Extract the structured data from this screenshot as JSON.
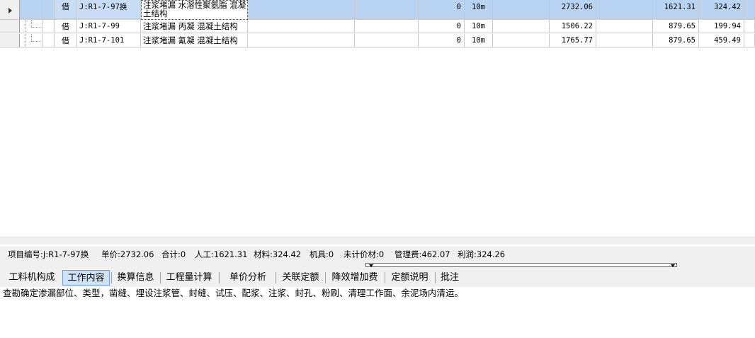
{
  "grid": {
    "rows": [
      {
        "type": "借",
        "code": "J:R1-7-97换",
        "name": "注浆堵漏 水溶性聚氨脂 混凝土结构",
        "qty": "0",
        "unit": "10m",
        "price": "2732.06",
        "labor": "1621.31",
        "material": "324.42",
        "selected": true
      },
      {
        "type": "借",
        "code": "J:R1-7-99",
        "name": "注浆堵漏 丙凝 混凝土结构",
        "qty": "0",
        "unit": "10m",
        "price": "1506.22",
        "labor": "879.65",
        "material": "199.94",
        "selected": false
      },
      {
        "type": "借",
        "code": "J:R1-7-101",
        "name": "注浆堵漏 氰凝 混凝土结构",
        "qty": "0",
        "unit": "10m",
        "price": "1765.77",
        "labor": "879.65",
        "material": "459.49",
        "selected": false
      }
    ]
  },
  "infobar": {
    "code": "项目编号:J:R1-7-97换",
    "unit_price": "单价:2732.06",
    "total": "合计:0",
    "labor": "人工:1621.31",
    "material": "材料:324.42",
    "machine": "机具:0",
    "unpriced": "未计价材:0",
    "mgmt": "管理费:462.07",
    "profit": "利润:324.26"
  },
  "tabs": [
    {
      "label": "工料机构成",
      "active": false
    },
    {
      "label": "工作内容",
      "active": true
    },
    {
      "label": "换算信息",
      "active": false
    },
    {
      "label": "工程量计算",
      "active": false
    },
    {
      "label": "单价分析",
      "active": false
    },
    {
      "label": "关联定额",
      "active": false
    },
    {
      "label": "降效增加费",
      "active": false
    },
    {
      "label": "定额说明",
      "active": false
    },
    {
      "label": "批注",
      "active": false
    }
  ],
  "work_content": "查勘确定渗漏部位、类型，凿缝、埋设注浆管、封缝、试压、配浆、注浆、封孔、粉刷、清理工作面、余泥场内清运。",
  "colors": {
    "selected_row": "#b9d3f3",
    "active_tab": "#cfe2f8"
  }
}
